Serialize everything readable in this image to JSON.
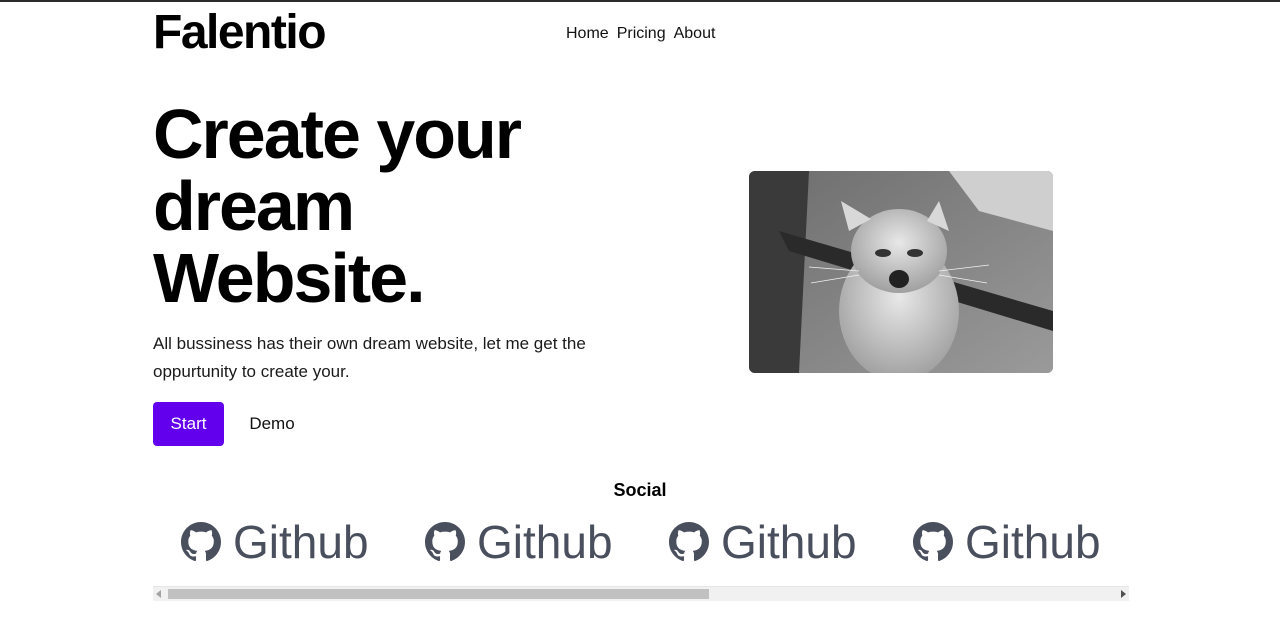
{
  "brand": {
    "name": "Falentio"
  },
  "nav": {
    "items": [
      {
        "label": "Home"
      },
      {
        "label": "Pricing"
      },
      {
        "label": "About"
      }
    ]
  },
  "hero": {
    "title": "Create your dream Website.",
    "description": "All bussiness has their own dream website, let me get the oppurtunity to create your.",
    "start_label": "Start",
    "demo_label": "Demo",
    "image_icon": "cat-photo"
  },
  "social": {
    "title": "Social",
    "items": [
      {
        "label": "Github",
        "icon": "github-icon"
      },
      {
        "label": "Github",
        "icon": "github-icon"
      },
      {
        "label": "Github",
        "icon": "github-icon"
      },
      {
        "label": "Github",
        "icon": "github-icon"
      }
    ]
  },
  "colors": {
    "accent": "#6200ee",
    "social_text": "#4a4f5e"
  }
}
